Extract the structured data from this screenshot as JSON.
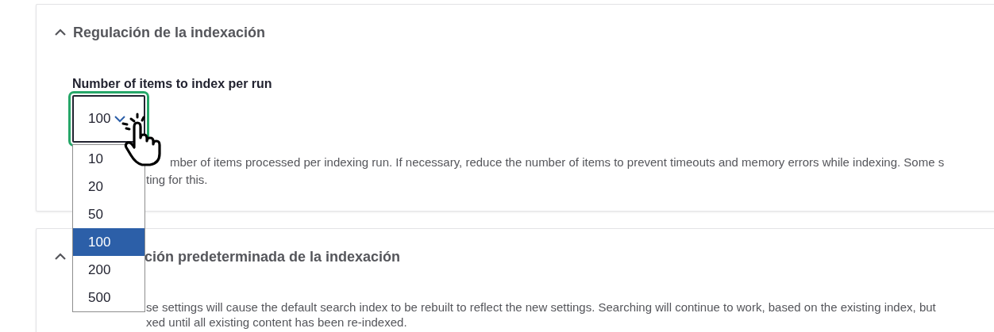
{
  "sections": [
    {
      "title": "Regulación de la indexación",
      "expanded": true,
      "field": {
        "label": "Number of items to index per run",
        "value": "100",
        "options": [
          {
            "label": "10",
            "selected": false
          },
          {
            "label": "20",
            "selected": false
          },
          {
            "label": "50",
            "selected": false
          },
          {
            "label": "100",
            "selected": true
          },
          {
            "label": "200",
            "selected": false
          },
          {
            "label": "500",
            "selected": false
          }
        ],
        "description": [
          "mber of items processed per indexing run. If necessary, reduce the number of items to prevent timeouts and memory errors while indexing. Some s",
          "ting for this."
        ]
      }
    },
    {
      "title": "ción predeterminada de la indexación",
      "expanded": true,
      "description": [
        "se settings will cause the default search index to be rebuilt to reflect the new settings. Searching will continue to work, based on the existing index, but",
        "xed until all existing content has been re-indexed."
      ]
    }
  ]
}
